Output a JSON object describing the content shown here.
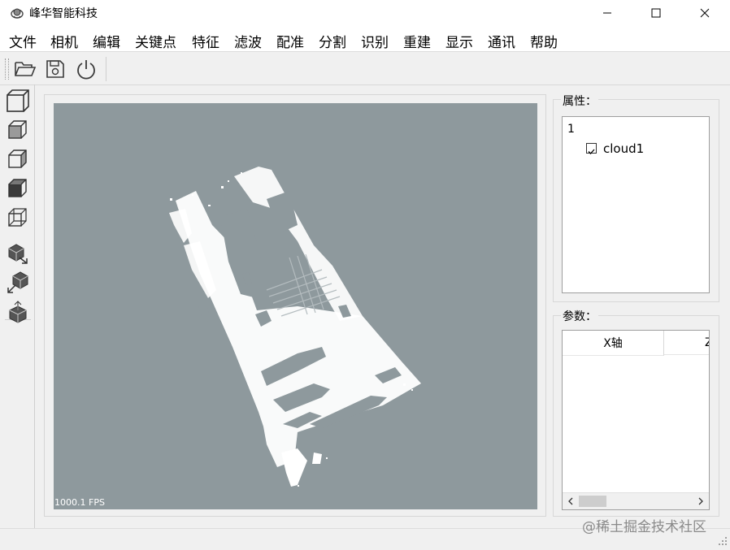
{
  "window": {
    "title": "峰华智能科技",
    "icon": "app-logo-icon"
  },
  "window_controls": {
    "minimize": "minimize-icon",
    "maximize": "maximize-icon",
    "close": "close-icon"
  },
  "menu": [
    "文件",
    "相机",
    "编辑",
    "关键点",
    "特征",
    "滤波",
    "配准",
    "分割",
    "识别",
    "重建",
    "显示",
    "通讯",
    "帮助"
  ],
  "toolbar": {
    "buttons": [
      "open-folder-icon",
      "save-icon",
      "power-icon"
    ]
  },
  "view_toolbar": {
    "buttons": [
      "cube-iso-view-icon",
      "cube-front-view-icon",
      "cube-right-view-icon",
      "cube-top-view-icon",
      "cube-wireframe-view-icon",
      "cube-rotate-out-icon",
      "cube-rotate-in-icon",
      "cube-move-up-icon"
    ]
  },
  "viewer": {
    "fps": "1000.1 FPS",
    "background": "#8e999d",
    "point_color": "#ffffff"
  },
  "properties": {
    "title": "属性：",
    "tree_root": "1",
    "tree_items": [
      {
        "label": "cloud1",
        "checked": true
      }
    ]
  },
  "params": {
    "title": "参数：",
    "columns": [
      "X轴",
      "Z"
    ]
  },
  "watermark": "@稀土掘金技术社区"
}
